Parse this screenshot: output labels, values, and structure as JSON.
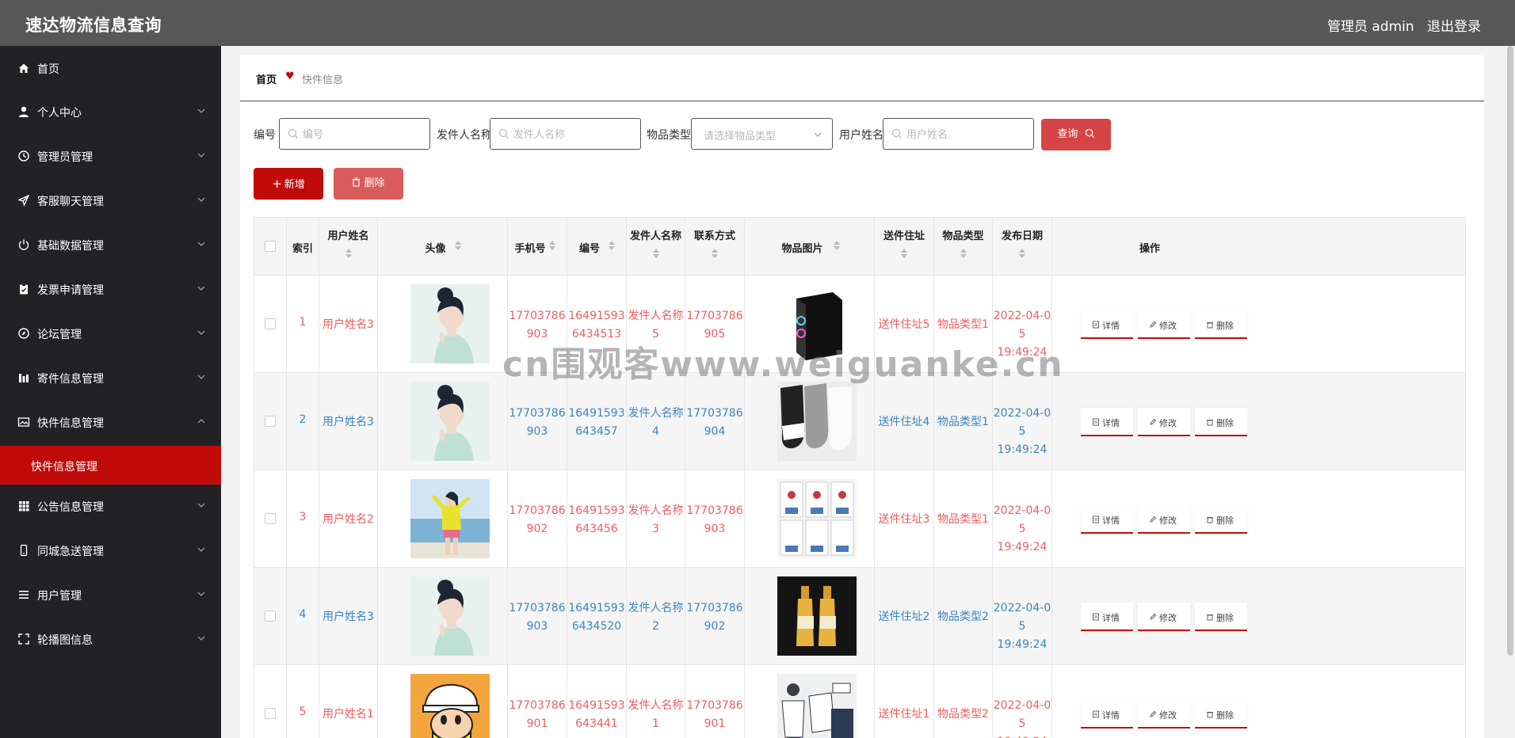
{
  "header": {
    "app_title": "速达物流信息查询",
    "admin_label": "管理员 admin",
    "logout": "退出登录"
  },
  "sidebar": {
    "items": [
      {
        "label": "首页",
        "icon": "home-icon"
      },
      {
        "label": "个人中心",
        "icon": "user-icon"
      },
      {
        "label": "管理员管理",
        "icon": "clock-icon"
      },
      {
        "label": "客服聊天管理",
        "icon": "send-icon"
      },
      {
        "label": "基础数据管理",
        "icon": "power-icon"
      },
      {
        "label": "发票申请管理",
        "icon": "clipboard-check-icon"
      },
      {
        "label": "论坛管理",
        "icon": "compass-icon"
      },
      {
        "label": "寄件信息管理",
        "icon": "bar-chart-icon"
      },
      {
        "label": "快件信息管理",
        "icon": "image-icon"
      },
      {
        "label": "公告信息管理",
        "icon": "grid-icon"
      },
      {
        "label": "同城急送管理",
        "icon": "phone-icon"
      },
      {
        "label": "用户管理",
        "icon": "list-icon"
      },
      {
        "label": "轮播图信息",
        "icon": "fullscreen-icon"
      }
    ],
    "active_sub": "快件信息管理"
  },
  "breadcrumb": {
    "home": "首页",
    "current": "快件信息"
  },
  "filters": {
    "number_label": "编号",
    "number_placeholder": "编号",
    "sender_label": "发件人名称",
    "sender_placeholder": "发件人名称",
    "type_label": "物品类型",
    "type_placeholder": "请选择物品类型",
    "username_label": "用户姓名",
    "username_placeholder": "用户姓名",
    "search_button": "查询"
  },
  "toolbar": {
    "add": "新增",
    "delete": "删除"
  },
  "table": {
    "headers": {
      "index": "索引",
      "username": "用户姓名",
      "avatar": "头像",
      "phone": "手机号",
      "number": "编号",
      "sender": "发件人名称",
      "contact": "联系方式",
      "image": "物品图片",
      "address": "送件住址",
      "type": "物品类型",
      "date": "发布日期",
      "actions": "操作"
    },
    "actions": {
      "detail": "详情",
      "edit": "修改",
      "delete": "删除"
    },
    "rows": [
      {
        "index": "1",
        "username": "用户姓名3",
        "phone": [
          "17703786",
          "903"
        ],
        "number": [
          "16491593",
          "6434513"
        ],
        "sender": [
          "发件人名称",
          "5"
        ],
        "contact": [
          "17703786",
          "905"
        ],
        "address": "送件住址5",
        "type": "物品类型1",
        "date": [
          "2022-04-0",
          "5 19:49:24"
        ],
        "color": "red",
        "avatar": "woman-bun",
        "image": "pc-case"
      },
      {
        "index": "2",
        "username": "用户姓名3",
        "phone": [
          "17703786",
          "903"
        ],
        "number": [
          "16491593",
          "643457"
        ],
        "sender": [
          "发件人名称",
          "4"
        ],
        "contact": [
          "17703786",
          "904"
        ],
        "address": "送件住址4",
        "type": "物品类型1",
        "date": [
          "2022-04-0",
          "5 19:49:24"
        ],
        "color": "blue",
        "avatar": "woman-bun",
        "image": "socks"
      },
      {
        "index": "3",
        "username": "用户姓名2",
        "phone": [
          "17703786",
          "902"
        ],
        "number": [
          "16491593",
          "643456"
        ],
        "sender": [
          "发件人名称",
          "3"
        ],
        "contact": [
          "17703786",
          "903"
        ],
        "address": "送件住址3",
        "type": "物品类型1",
        "date": [
          "2022-04-0",
          "5 19:49:24"
        ],
        "color": "red",
        "avatar": "woman-beach",
        "image": "shirts"
      },
      {
        "index": "4",
        "username": "用户姓名3",
        "phone": [
          "17703786",
          "903"
        ],
        "number": [
          "16491593",
          "6434520"
        ],
        "sender": [
          "发件人名称",
          "2"
        ],
        "contact": [
          "17703786",
          "902"
        ],
        "address": "送件住址2",
        "type": "物品类型2",
        "date": [
          "2022-04-0",
          "5 19:49:24"
        ],
        "color": "blue",
        "avatar": "woman-bun",
        "image": "bottles"
      },
      {
        "index": "5",
        "username": "用户姓名1",
        "phone": [
          "17703786",
          "901"
        ],
        "number": [
          "16491593",
          "643441"
        ],
        "sender": [
          "发件人名称",
          "1"
        ],
        "contact": [
          "17703786",
          "901"
        ],
        "address": "送件住址1",
        "type": "物品类型2",
        "date": [
          "2022-04-0",
          "5 19:49:24"
        ],
        "color": "red",
        "avatar": "cartoon-boy",
        "image": "clothes"
      }
    ]
  },
  "watermark": "cn围观客www.weiguanke.cn",
  "colors": {
    "header_bg": "#575757",
    "sidebar_bg": "#222224",
    "accent": "#c10b0b",
    "red_text": "#ea5f5f",
    "blue_text": "#3c84c4"
  }
}
